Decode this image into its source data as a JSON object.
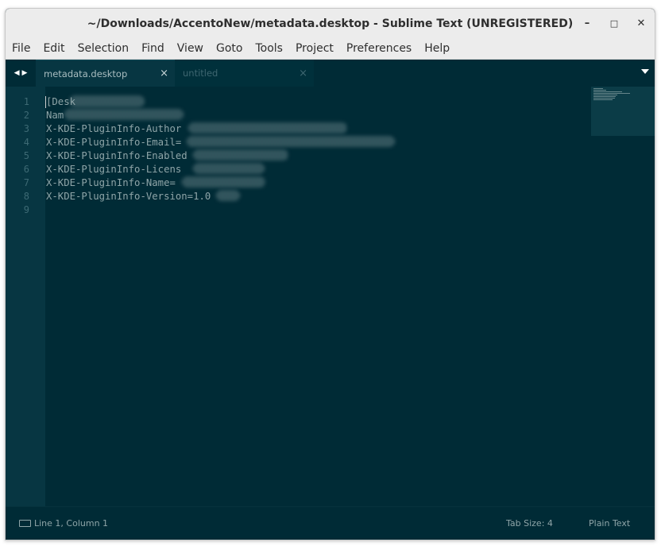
{
  "window": {
    "title": "~/Downloads/AccentoNew/metadata.desktop - Sublime Text (UNREGISTERED)",
    "controls": {
      "minimize": "–",
      "maximize": "□",
      "close": "✕"
    }
  },
  "menu": [
    "File",
    "Edit",
    "Selection",
    "Find",
    "View",
    "Goto",
    "Tools",
    "Project",
    "Preferences",
    "Help"
  ],
  "tabs": [
    {
      "label": "metadata.desktop",
      "close": "×",
      "active": true
    },
    {
      "label": "untitled",
      "close": "×",
      "active": false
    }
  ],
  "nav": {
    "back": "◀",
    "forward": "▶"
  },
  "editor": {
    "line_numbers": [
      "1",
      "2",
      "3",
      "4",
      "5",
      "6",
      "7",
      "8",
      "9"
    ],
    "lines": [
      "[Desk",
      "Nam",
      "X-KDE-PluginInfo-Author",
      "X-KDE-PluginInfo-Email=",
      "X-KDE-PluginInfo-Enabled",
      "X-KDE-PluginInfo-Licens",
      "X-KDE-PluginInfo-Name=",
      "X-KDE-PluginInfo-Version=1.0",
      ""
    ]
  },
  "status": {
    "position": "Line 1, Column 1",
    "tab_size": "Tab Size: 4",
    "syntax": "Plain Text"
  },
  "colors": {
    "background": "#002b36",
    "gutter": "#073642",
    "text": "#8fa5a8",
    "chrome": "#ececec"
  }
}
